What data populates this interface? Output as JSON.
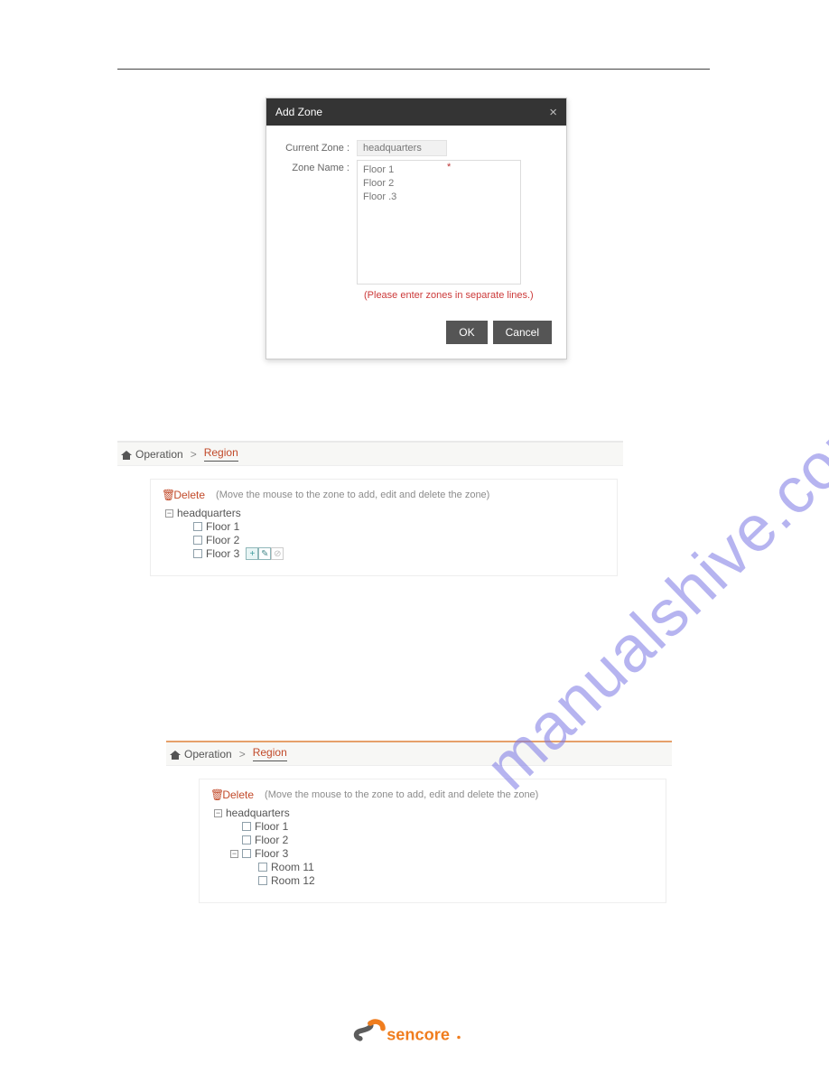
{
  "dialog": {
    "title": "Add Zone",
    "close_label": "×",
    "current_zone_label": "Current Zone :",
    "current_zone_value": "headquarters",
    "zone_name_label": "Zone Name :",
    "zone_name_value": "Floor 1\nFloor 2\nFloor .3",
    "required_mark": "*",
    "hint": "(Please enter zones in separate lines.)",
    "ok_label": "OK",
    "cancel_label": "Cancel"
  },
  "panel1": {
    "crumb_root": "Operation",
    "crumb_sep": ">",
    "crumb_active": "Region",
    "delete_label": "Delete",
    "instruction": "(Move the mouse to the zone to add, edit and delete the zone)",
    "tree": {
      "root": "headquarters",
      "toggle_root": "−",
      "children": [
        {
          "label": "Floor 1"
        },
        {
          "label": "Floor 2"
        },
        {
          "label": "Floor 3",
          "tools": true
        }
      ],
      "tool_add": "+",
      "tool_edit": "✎",
      "tool_del": "⊘"
    }
  },
  "panel2": {
    "crumb_root": "Operation",
    "crumb_sep": ">",
    "crumb_active": "Region",
    "delete_label": "Delete",
    "instruction": "(Move the mouse to the zone to add, edit and delete the zone)",
    "tree": {
      "root": "headquarters",
      "toggle_root": "−",
      "children": [
        {
          "label": "Floor 1"
        },
        {
          "label": "Floor 2"
        },
        {
          "label": "Floor 3",
          "toggle": "−",
          "children": [
            {
              "label": "Room 11"
            },
            {
              "label": "Room 12"
            }
          ]
        }
      ]
    }
  },
  "logo_text": "sencore",
  "watermark": "manualshive.com"
}
